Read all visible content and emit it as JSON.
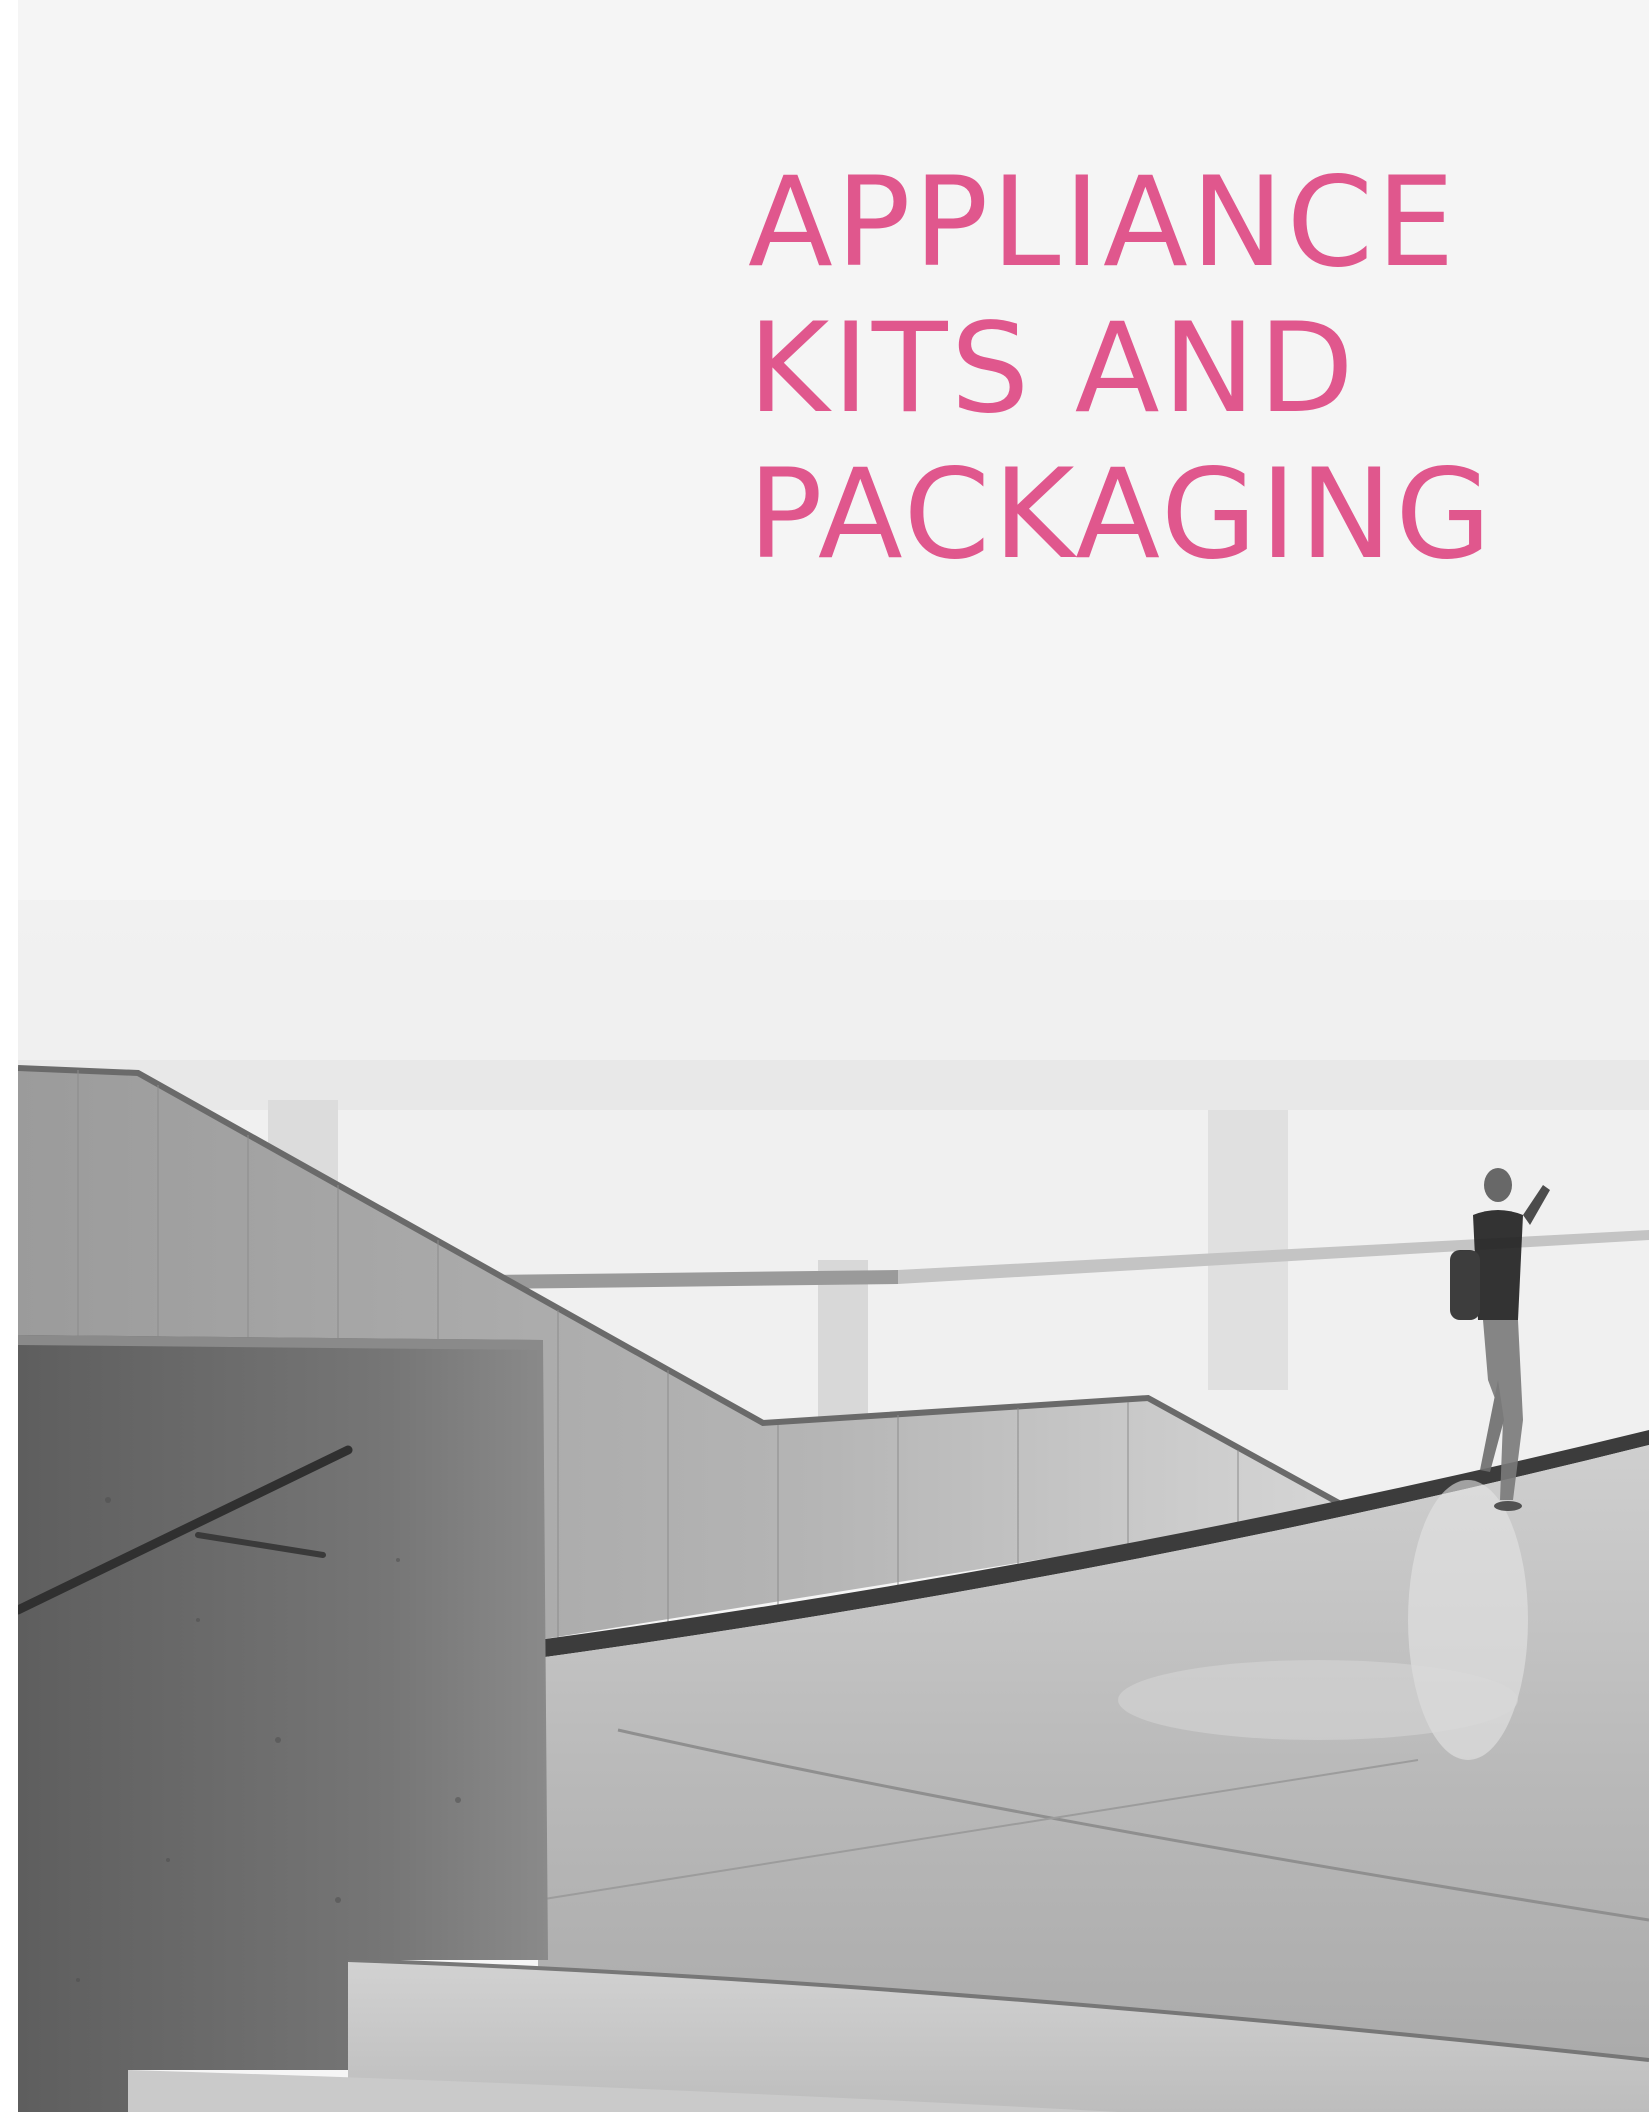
{
  "cover": {
    "title_lines": [
      "APPLIANCE",
      "KITS AND",
      "PACKAGING"
    ],
    "title_color": "#e0578d",
    "background_color": "#f5f5f5"
  },
  "photo": {
    "description_icon": "interior-stair-ramp-photo"
  }
}
